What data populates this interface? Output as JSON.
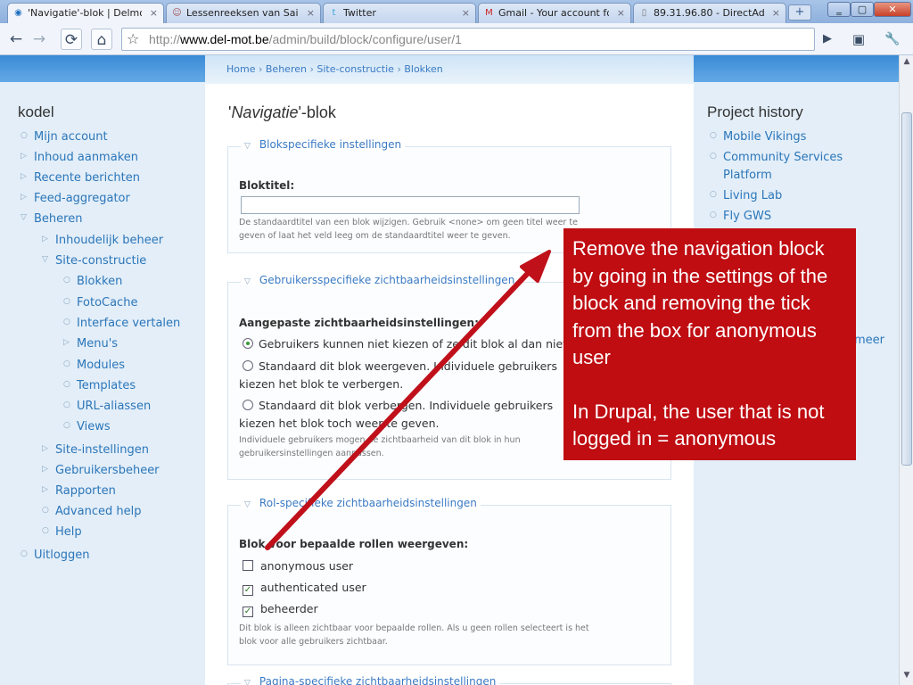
{
  "browser": {
    "tabs": [
      {
        "label": "'Navigatie'-blok | Delmot",
        "favicon": "drupal-icon",
        "active": true
      },
      {
        "label": "Lessenreeksen van Sai...",
        "favicon": "avatar-icon",
        "active": false
      },
      {
        "label": "Twitter",
        "favicon": "twitter-icon",
        "active": false
      },
      {
        "label": "Gmail - Your account fo...",
        "favicon": "gmail-icon",
        "active": false
      },
      {
        "label": "89.31.96.80 - DirectAd...",
        "favicon": "page-icon",
        "active": false
      }
    ],
    "url_domain": "www.del-mot.be",
    "url_path": "/admin/build/block/configure/user/1",
    "url_prefix": "http://"
  },
  "breadcrumb": [
    "Home",
    "Beheren",
    "Site-constructie",
    "Blokken"
  ],
  "breadcrumb_sep": "›",
  "left_sidebar": {
    "title": "kodel",
    "items": [
      "Mijn account",
      "Inhoud aanmaken",
      "Recente berichten",
      "Feed-aggregator",
      "Beheren",
      "Inhoudelijk beheer",
      "Site-constructie",
      "Blokken",
      "FotoCache",
      "Interface vertalen",
      "Menu's",
      "Modules",
      "Templates",
      "URL-aliassen",
      "Views",
      "Site-instellingen",
      "Gebruikersbeheer",
      "Rapporten",
      "Advanced help",
      "Help",
      "Uitloggen"
    ]
  },
  "right_sidebar": {
    "title": "Project history",
    "items": [
      "Mobile Vikings",
      "Community Services",
      "Platform",
      "Living Lab",
      "Fly GWS"
    ],
    "more": "meer"
  },
  "main": {
    "title_quote_open": "'",
    "title_italic": "Navigatie",
    "title_rest": "'-blok",
    "fieldset1": {
      "legend": "Blokspecifieke instellingen",
      "label": "Bloktitel:",
      "value": "",
      "desc1": "De standaardtitel van een blok wijzigen. Gebruik <none> om geen titel weer te",
      "desc2": "geven of laat het veld leeg om de standaardtitel weer te geven."
    },
    "fieldset2": {
      "legend": "Gebruikersspecifieke zichtbaarheidsinstellingen",
      "label": "Aangepaste zichtbaarheidsinstellingen:",
      "opt1": "Gebruikers kunnen niet kiezen of ze dit blok al dan niet",
      "opt2a": "Standaard dit blok weergeven. Individuele gebruikers",
      "opt2b": "kiezen het blok te verbergen.",
      "opt3a": "Standaard dit blok verbergen. Individuele gebruikers",
      "opt3b": "kiezen het blok toch weer te geven.",
      "desc1": "Individuele gebruikers mogen de zichtbaarheid van dit blok in hun",
      "desc2": "gebruikersinstellingen aanpassen."
    },
    "fieldset3": {
      "legend": "Rol-specifieke zichtbaarheidsinstellingen",
      "label": "Blok voor bepaalde rollen weergeven:",
      "roles": [
        {
          "label": "anonymous user",
          "checked": false
        },
        {
          "label": "authenticated user",
          "checked": true
        },
        {
          "label": "beheerder",
          "checked": true
        }
      ],
      "desc1": "Dit blok is alleen zichtbaar voor bepaalde rollen. Als u geen rollen selecteert is het",
      "desc2": "blok voor alle gebruikers zichtbaar."
    },
    "fieldset4": {
      "legend": "Pagina-specifieke zichtbaarheidsinstellingen"
    }
  },
  "annotation": {
    "para1": "Remove the navigation block by going in the settings of the block and removing the tick from the box for anonymous user",
    "para2": "In Drupal, the user that is not logged in = anonymous",
    "color": "#bf0d12"
  },
  "icons": {
    "back": "←",
    "forward": "→",
    "reload": "⟳",
    "home": "⌂",
    "star": "☆",
    "go": "▶",
    "page": "▣",
    "wrench": "🔧",
    "minimize": "‗",
    "maximize": "▢",
    "close": "✕",
    "tab_close": "×",
    "new_tab": "+",
    "bullet": "○",
    "collapsed": "▷",
    "expanded": "▽",
    "check": "✓",
    "scroll_up": "▲",
    "scroll_down": "▼"
  }
}
